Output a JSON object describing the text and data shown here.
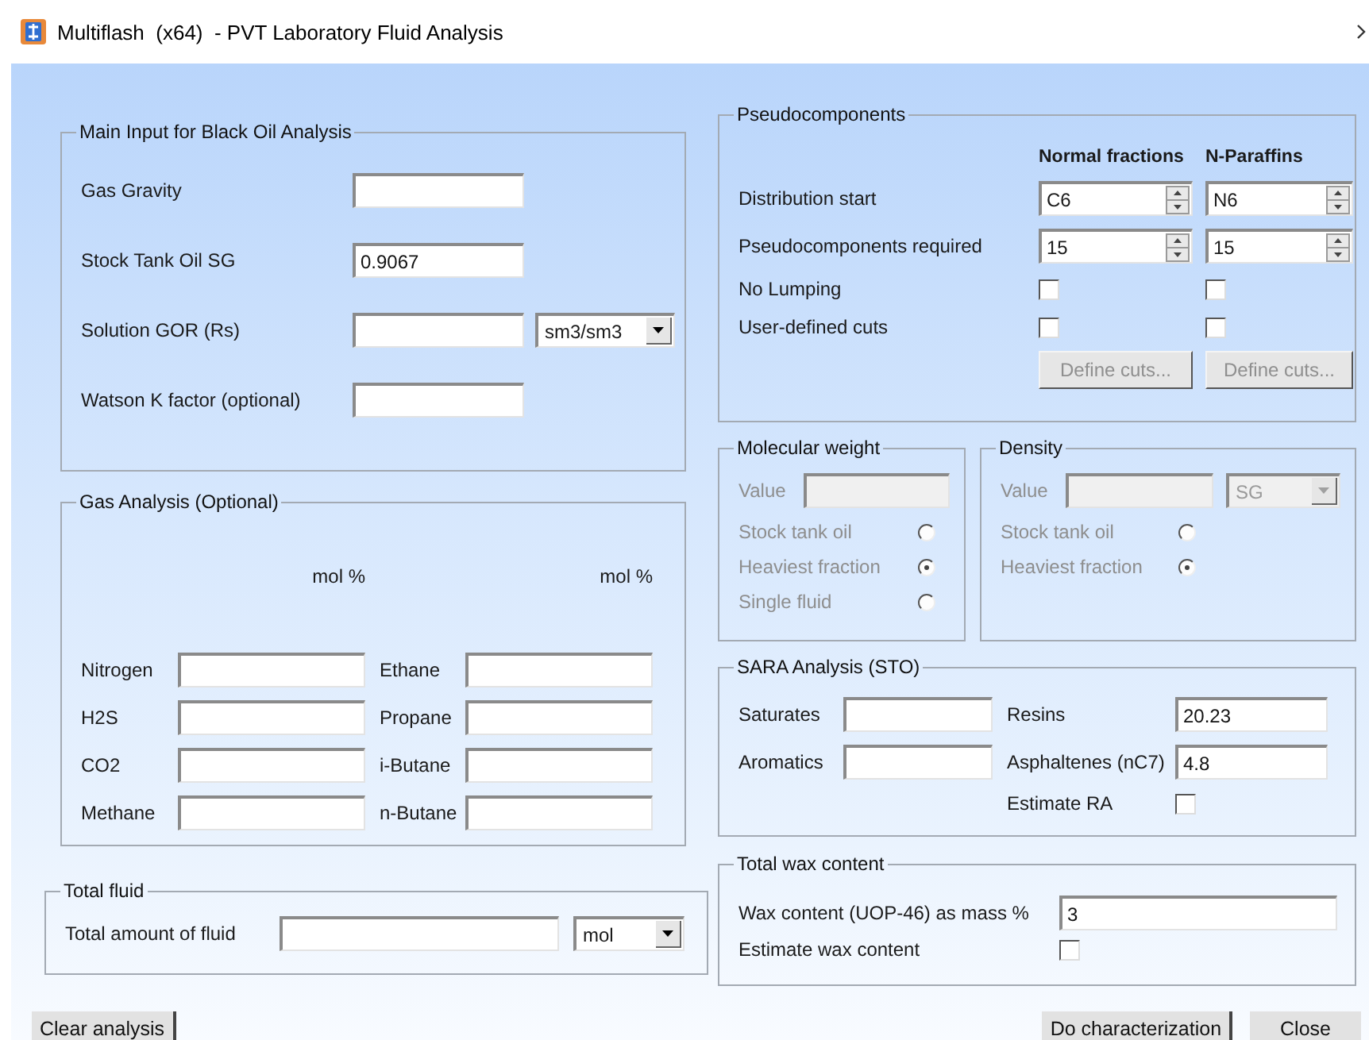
{
  "window": {
    "title": "Multiflash  (x64)  - PVT Laboratory Fluid Analysis"
  },
  "main_input": {
    "title": "Main Input for Black Oil Analysis",
    "fields": [
      {
        "label": "Gas Gravity"
      },
      {
        "label": "Stock Tank Oil SG",
        "value": "0.9067"
      },
      {
        "label": "Solution GOR (Rs)",
        "unit": "sm3/sm3"
      },
      {
        "label": "Watson K factor (optional)"
      }
    ]
  },
  "gas_analysis": {
    "title": "Gas Analysis (Optional)",
    "headers": [
      "mol %",
      "mol %"
    ],
    "left": [
      {
        "label": "Nitrogen"
      },
      {
        "label": "H2S"
      },
      {
        "label": "CO2"
      },
      {
        "label": "Methane"
      }
    ],
    "right": [
      {
        "label": "Ethane"
      },
      {
        "label": "Propane"
      },
      {
        "label": "i-Butane"
      },
      {
        "label": "n-Butane"
      }
    ]
  },
  "total_fluid": {
    "title": "Total fluid",
    "label": "Total amount of fluid",
    "unit": "mol"
  },
  "pseudocomponents": {
    "title": "Pseudocomponents",
    "columns": [
      "Normal fractions",
      "N-Paraffins"
    ],
    "rows": [
      {
        "kind": "spin",
        "label": "Distribution start",
        "values": [
          "C6",
          "N6"
        ]
      },
      {
        "kind": "spin",
        "label": "Pseudocomponents required",
        "values": [
          "15",
          "15"
        ]
      },
      {
        "kind": "check",
        "label": "No Lumping",
        "checked": [
          false,
          false
        ]
      },
      {
        "kind": "check",
        "label": "User-defined cuts",
        "checked": [
          false,
          false
        ]
      },
      {
        "kind": "buttons",
        "buttons": [
          {
            "label": "Define cuts...",
            "disabled": true
          },
          {
            "label": "Define cuts...",
            "disabled": true
          }
        ]
      }
    ]
  },
  "molecular_weight": {
    "title": "Molecular weight",
    "disabled": true,
    "value_label": "Value",
    "options": [
      {
        "label": "Stock tank oil",
        "selected": false
      },
      {
        "label": "Heaviest fraction",
        "selected": true
      },
      {
        "label": "Single fluid",
        "selected": false
      }
    ]
  },
  "density": {
    "title": "Density",
    "disabled": true,
    "value_label": "Value",
    "unit": "SG",
    "options": [
      {
        "label": "Stock tank oil",
        "selected": false
      },
      {
        "label": "Heaviest fraction",
        "selected": true
      }
    ]
  },
  "sara": {
    "title": "SARA Analysis (STO)",
    "fields": [
      {
        "label": "Saturates"
      },
      {
        "label": "Resins",
        "value": "20.23"
      },
      {
        "label": "Aromatics"
      },
      {
        "label": "Asphaltenes (nC7)",
        "value": "4.8"
      }
    ],
    "estimate": {
      "label": "Estimate RA",
      "checked": false
    }
  },
  "wax": {
    "title": "Total wax content",
    "label": "Wax content (UOP-46) as mass %",
    "value": "3",
    "estimate": {
      "label": "Estimate wax content",
      "checked": false
    }
  },
  "footer": {
    "left": [
      {
        "label": "Clear analysis"
      }
    ],
    "right": [
      {
        "label": "Do characterization"
      },
      {
        "label": "Close"
      }
    ]
  }
}
